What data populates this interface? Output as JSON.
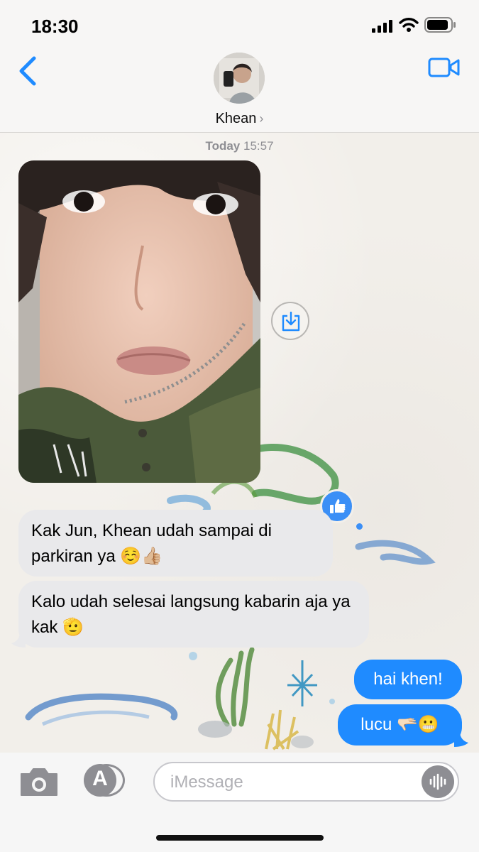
{
  "status_bar": {
    "time": "18:30"
  },
  "header": {
    "contact_name": "Khean",
    "chevron": "›"
  },
  "thread": {
    "timestamp_day": "Today",
    "timestamp_time": "15:57",
    "messages": [
      {
        "direction": "incoming",
        "type": "photo",
        "tapback": "thumbs-up"
      },
      {
        "direction": "incoming",
        "text": "Kak Jun, Khean udah sampai di parkiran ya ☺️👍🏼"
      },
      {
        "direction": "incoming",
        "text": "Kalo udah selesai langsung kabarin aja ya kak 🫡"
      },
      {
        "direction": "outgoing",
        "text": "hai khen!"
      },
      {
        "direction": "outgoing",
        "text": "lucu 🫳🏻😬"
      }
    ]
  },
  "composer": {
    "placeholder": "iMessage",
    "value": ""
  },
  "colors": {
    "accent": "#1f8bff",
    "incoming_bubble": "#e9e9eb",
    "tapback": "#3b8ff6"
  }
}
